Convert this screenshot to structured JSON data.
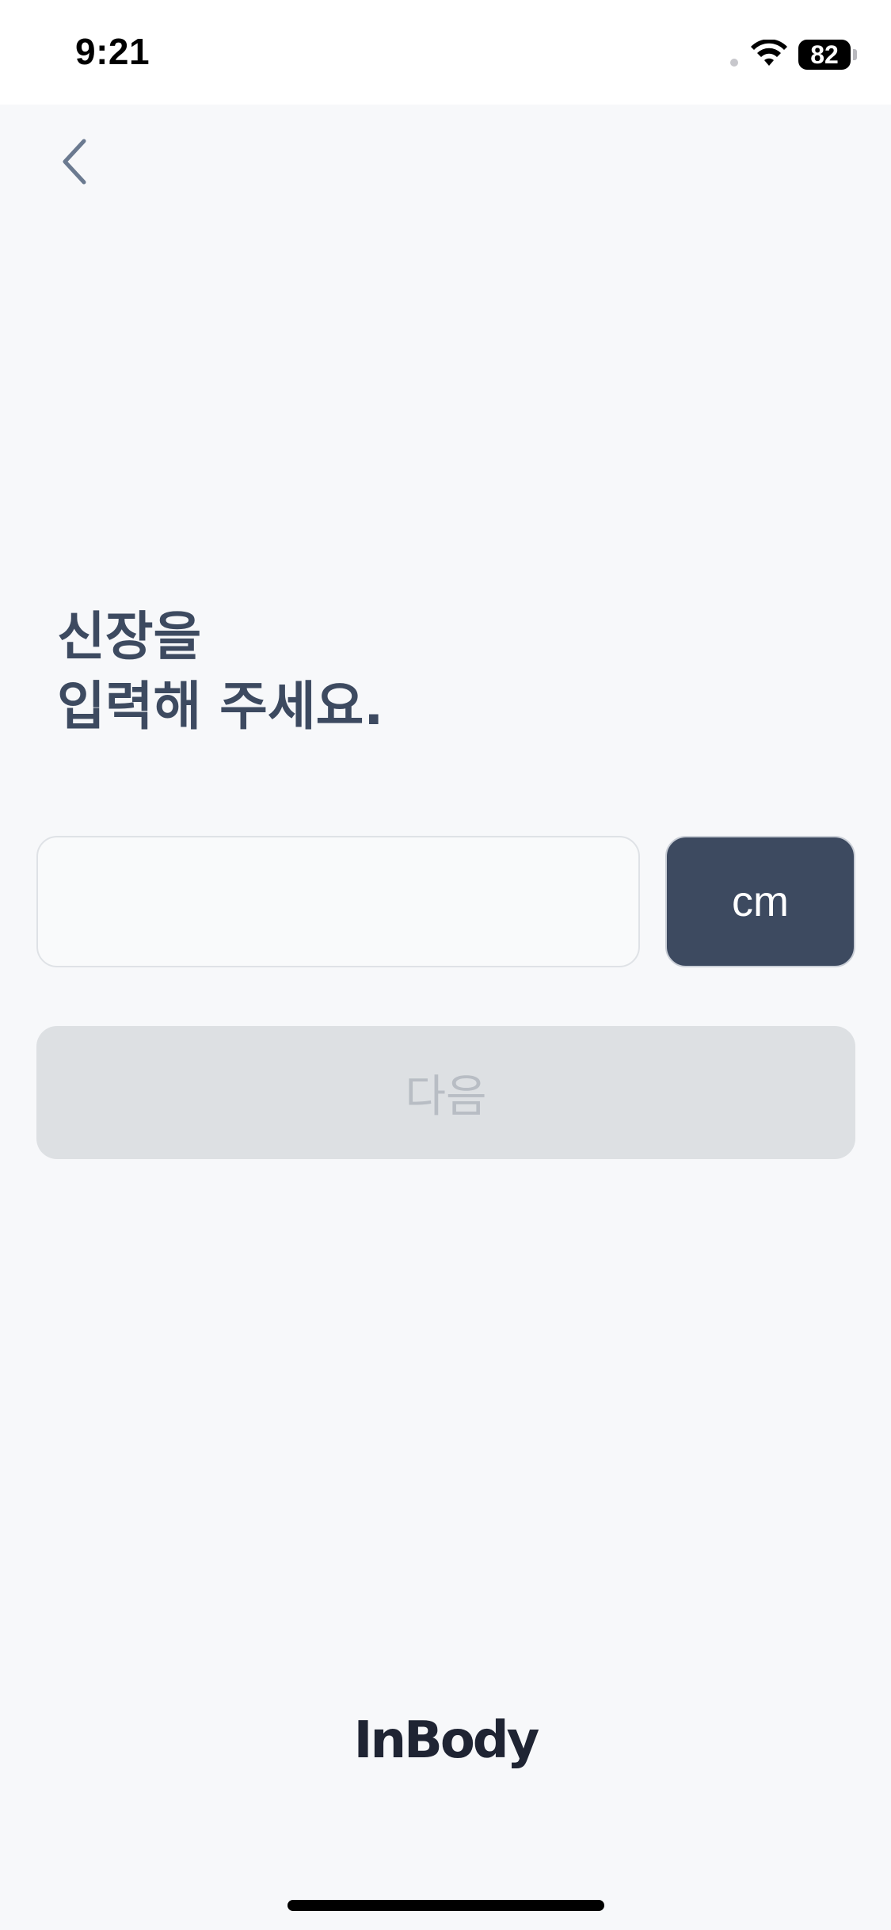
{
  "status_bar": {
    "time": "9:21",
    "battery_level": "82"
  },
  "header": {
    "back_icon": "chevron-left-icon"
  },
  "title": "신장을\n입력해 주세요.",
  "height_input": {
    "value": "",
    "placeholder": ""
  },
  "unit_button": {
    "label": "cm"
  },
  "next_button": {
    "label": "다음"
  },
  "footer": {
    "brand": "InBody"
  },
  "colors": {
    "primary": "#3d4a60",
    "background": "#f7f8fa",
    "disabled_bg": "#dde0e3",
    "disabled_text": "#b8bdc4"
  }
}
